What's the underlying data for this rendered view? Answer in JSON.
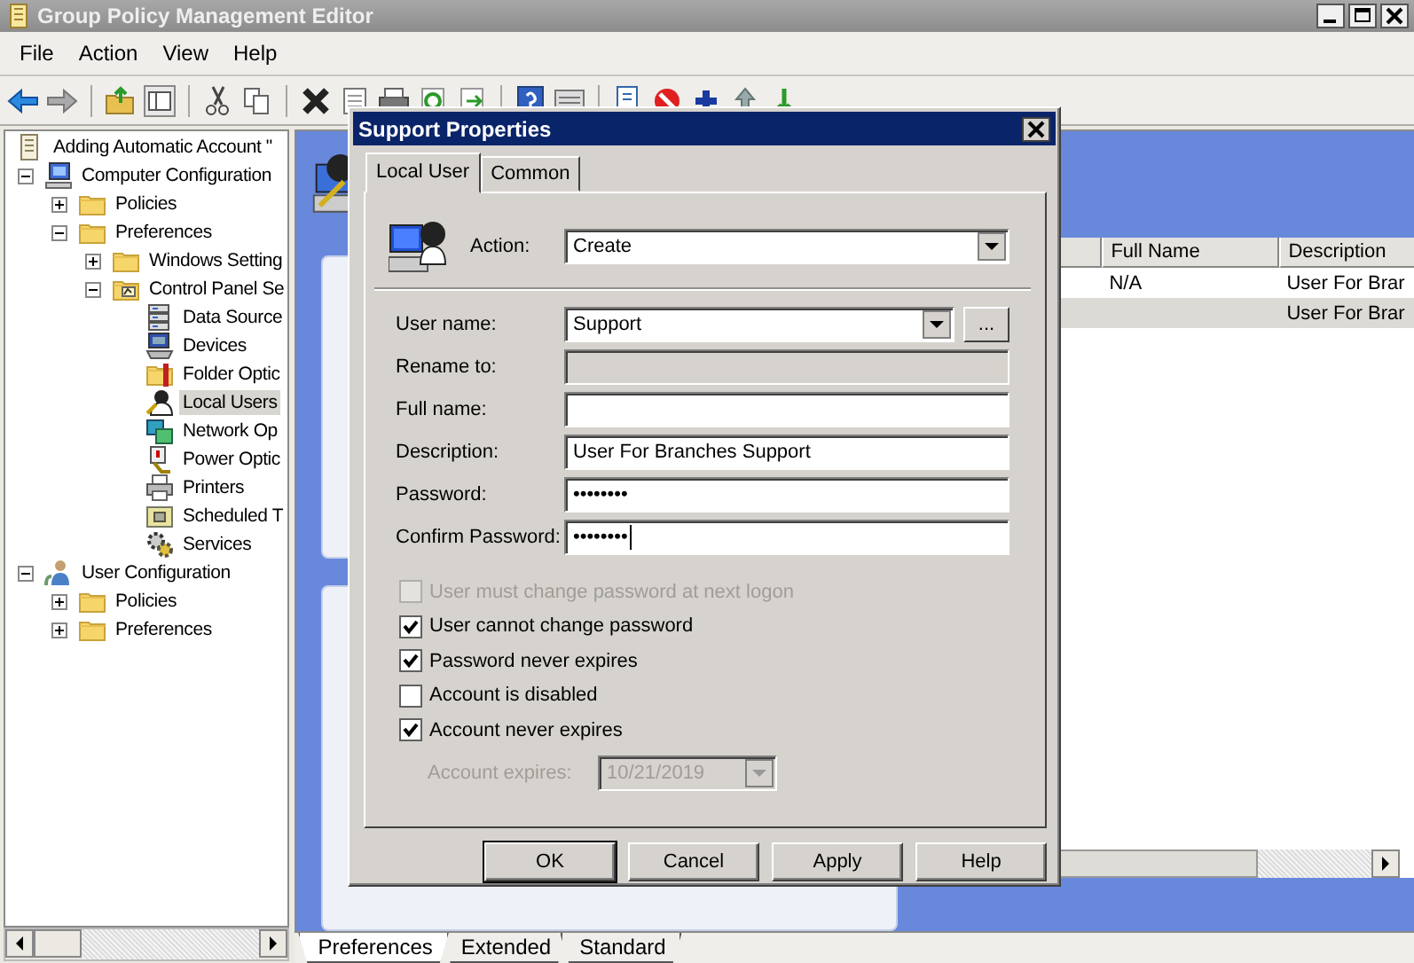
{
  "window": {
    "title": "Group Policy Management Editor"
  },
  "menu": [
    "File",
    "Action",
    "View",
    "Help"
  ],
  "tree": [
    {
      "label": "Adding Automatic Account \"",
      "kind": "gpo",
      "selected": false,
      "children": [
        {
          "label": "Computer Configuration",
          "kind": "computer",
          "expanded": true,
          "selected": false,
          "children": [
            {
              "label": "Policies",
              "kind": "folder",
              "expanded": false,
              "selected": false
            },
            {
              "label": "Preferences",
              "kind": "folder",
              "expanded": true,
              "selected": false,
              "children": [
                {
                  "label": "Windows Setting",
                  "kind": "folder",
                  "expanded": false,
                  "selected": false
                },
                {
                  "label": "Control Panel Se",
                  "kind": "cpanel",
                  "expanded": true,
                  "selected": false,
                  "children": [
                    {
                      "label": "Data Source",
                      "kind": "datasource",
                      "selected": false
                    },
                    {
                      "label": "Devices",
                      "kind": "devices",
                      "selected": false
                    },
                    {
                      "label": "Folder Optic",
                      "kind": "folderoptions",
                      "selected": false
                    },
                    {
                      "label": "Local Users",
                      "kind": "users",
                      "selected": true
                    },
                    {
                      "label": "Network Op",
                      "kind": "network",
                      "selected": false
                    },
                    {
                      "label": "Power Optic",
                      "kind": "power",
                      "selected": false
                    },
                    {
                      "label": "Printers",
                      "kind": "printer",
                      "selected": false
                    },
                    {
                      "label": "Scheduled T",
                      "kind": "scheduled",
                      "selected": false
                    },
                    {
                      "label": "Services",
                      "kind": "services",
                      "selected": false
                    }
                  ]
                }
              ]
            }
          ]
        },
        {
          "label": "User Configuration",
          "kind": "userconfig",
          "expanded": true,
          "selected": false,
          "children": [
            {
              "label": "Policies",
              "kind": "folder",
              "expanded": false,
              "selected": false
            },
            {
              "label": "Preferences",
              "kind": "folder",
              "expanded": false,
              "selected": false
            }
          ]
        }
      ]
    }
  ],
  "list": {
    "columns": [
      "Full Name",
      "Description"
    ],
    "rows": [
      {
        "full_name": "N/A",
        "description": "User For Brar",
        "selected": false
      },
      {
        "description": "User For Brar",
        "selected": true
      }
    ]
  },
  "bottom_tabs": [
    {
      "label": "Preferences",
      "selected": true
    },
    {
      "label": "Extended",
      "selected": false
    },
    {
      "label": "Standard",
      "selected": false
    }
  ],
  "dialog": {
    "title": "Support Properties",
    "tabs": [
      {
        "label": "Local User",
        "selected": true
      },
      {
        "label": "Common",
        "selected": false
      }
    ],
    "action": {
      "label": "Action:",
      "value": "Create"
    },
    "fields": [
      {
        "label": "User name:",
        "kind": "combo",
        "value": "Support",
        "browse": "...",
        "disabled": false,
        "focused": false
      },
      {
        "label": "Rename to:",
        "kind": "text",
        "disabled": true,
        "focused": false
      },
      {
        "label": "Full name:",
        "kind": "text",
        "disabled": false,
        "focused": false
      },
      {
        "label": "Description:",
        "kind": "text",
        "value": "User For Branches Support",
        "disabled": false,
        "focused": false
      },
      {
        "label": "Password:",
        "kind": "text",
        "value": "••••••••",
        "disabled": false,
        "focused": false
      },
      {
        "label": "Confirm Password:",
        "kind": "text",
        "value": "••••••••",
        "disabled": false,
        "focused": true
      }
    ],
    "checkboxes": [
      {
        "label": "User must change password at next logon",
        "checked": false,
        "disabled": true
      },
      {
        "label": "User cannot change password",
        "checked": true,
        "disabled": false
      },
      {
        "label": "Password never expires",
        "checked": true,
        "disabled": false
      },
      {
        "label": "Account is disabled",
        "checked": false,
        "disabled": false
      },
      {
        "label": "Account never expires",
        "checked": true,
        "disabled": false
      }
    ],
    "expires": {
      "label": "Account expires:",
      "value": "10/21/2019",
      "disabled": true
    },
    "buttons": [
      {
        "label": "OK",
        "default": true
      },
      {
        "label": "Cancel",
        "default": false
      },
      {
        "label": "Apply",
        "default": false
      },
      {
        "label": "Help",
        "default": false
      }
    ]
  }
}
